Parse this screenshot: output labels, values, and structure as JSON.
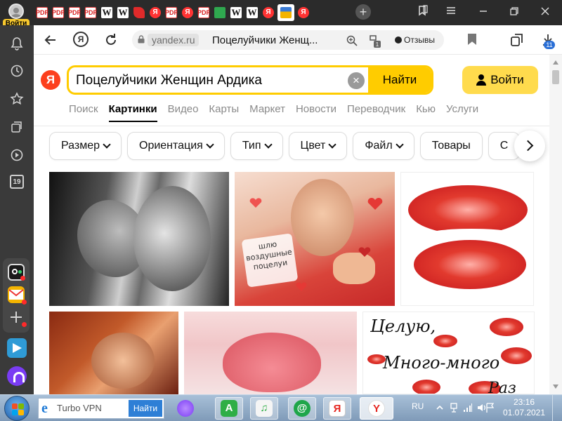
{
  "browser": {
    "profile_login_label": "Войти",
    "tabs": [
      {
        "icon": "pdf-icon",
        "glyph": "PDF"
      },
      {
        "icon": "pdf-icon",
        "glyph": "PDF"
      },
      {
        "icon": "pdf-icon",
        "glyph": "PDF"
      },
      {
        "icon": "pdf-icon",
        "glyph": "PDF"
      },
      {
        "icon": "wikipedia-icon",
        "glyph": "W"
      },
      {
        "icon": "wikipedia-icon",
        "glyph": "W"
      },
      {
        "icon": "red-shape-icon",
        "glyph": ""
      },
      {
        "icon": "yandex-icon",
        "glyph": "Я"
      },
      {
        "icon": "pdf-icon",
        "glyph": "PDF"
      },
      {
        "icon": "yandex-icon",
        "glyph": "Я"
      },
      {
        "icon": "pdf-icon",
        "glyph": "PDF"
      },
      {
        "icon": "green-square-icon",
        "glyph": ""
      },
      {
        "icon": "wikipedia-icon",
        "glyph": "W"
      },
      {
        "icon": "wikipedia-icon",
        "glyph": "W"
      },
      {
        "icon": "yandex-icon",
        "glyph": "Я"
      },
      {
        "icon": "image-icon",
        "glyph": "",
        "active": true
      },
      {
        "icon": "yandex-icon",
        "glyph": "Я"
      }
    ],
    "new_tab_label": "+",
    "sidebar_calendar_day": "19",
    "domain": "yandex.ru",
    "page_title": "Поцелуйчики Женщ...",
    "reviews_label": "Отзывы",
    "downloads_badge": "11"
  },
  "yandex": {
    "logo_letter": "Я",
    "search_value": "Поцелуйчики Женщин Ардика",
    "search_button": "Найти",
    "login_button": "Войти",
    "services": [
      {
        "label": "Поиск",
        "active": false
      },
      {
        "label": "Картинки",
        "active": true
      },
      {
        "label": "Видео",
        "active": false
      },
      {
        "label": "Карты",
        "active": false
      },
      {
        "label": "Маркет",
        "active": false
      },
      {
        "label": "Новости",
        "active": false
      },
      {
        "label": "Переводчик",
        "active": false
      },
      {
        "label": "Кью",
        "active": false
      },
      {
        "label": "Услуги",
        "active": false
      }
    ],
    "filters": [
      {
        "label": "Размер",
        "dropdown": true
      },
      {
        "label": "Ориентация",
        "dropdown": true
      },
      {
        "label": "Тип",
        "dropdown": true
      },
      {
        "label": "Цвет",
        "dropdown": true
      },
      {
        "label": "Файл",
        "dropdown": true
      },
      {
        "label": "Товары",
        "dropdown": false
      },
      {
        "label": "С",
        "dropdown": false
      }
    ],
    "image_texts": {
      "kiss_card": "шлю воздушные поцелуи",
      "card_line1": "Целую,",
      "card_line2": "Много-много",
      "card_line3": "Раз"
    }
  },
  "taskbar": {
    "search_text": "Turbo VPN",
    "search_button": "Найти",
    "apps": [
      "alice-icon",
      "green-a-icon",
      "music-icon",
      "at-mail-icon",
      "yandex-browser-icon",
      "yandex-y-icon"
    ],
    "language": "RU",
    "time": "23:16",
    "date": "01.07.2021"
  },
  "colors": {
    "accent_yellow": "#ffcc00",
    "yandex_red": "#fc3f1d",
    "login_yellow": "#ffdb4d",
    "tabbar_dark": "#2b2b2b"
  }
}
